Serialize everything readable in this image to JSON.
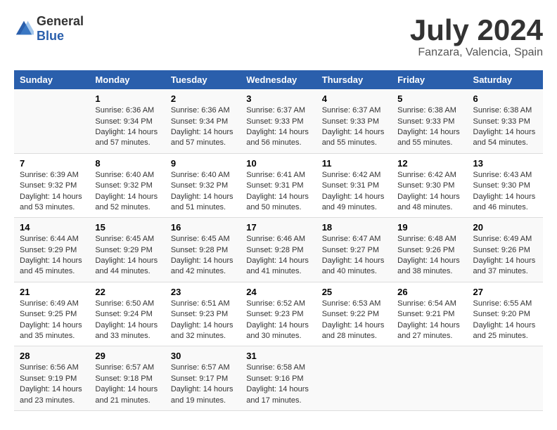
{
  "header": {
    "logo_general": "General",
    "logo_blue": "Blue",
    "title": "July 2024",
    "subtitle": "Fanzara, Valencia, Spain"
  },
  "days_of_week": [
    "Sunday",
    "Monday",
    "Tuesday",
    "Wednesday",
    "Thursday",
    "Friday",
    "Saturday"
  ],
  "weeks": [
    [
      {
        "day": "",
        "info": ""
      },
      {
        "day": "1",
        "info": "Sunrise: 6:36 AM\nSunset: 9:34 PM\nDaylight: 14 hours\nand 57 minutes."
      },
      {
        "day": "2",
        "info": "Sunrise: 6:36 AM\nSunset: 9:34 PM\nDaylight: 14 hours\nand 57 minutes."
      },
      {
        "day": "3",
        "info": "Sunrise: 6:37 AM\nSunset: 9:33 PM\nDaylight: 14 hours\nand 56 minutes."
      },
      {
        "day": "4",
        "info": "Sunrise: 6:37 AM\nSunset: 9:33 PM\nDaylight: 14 hours\nand 55 minutes."
      },
      {
        "day": "5",
        "info": "Sunrise: 6:38 AM\nSunset: 9:33 PM\nDaylight: 14 hours\nand 55 minutes."
      },
      {
        "day": "6",
        "info": "Sunrise: 6:38 AM\nSunset: 9:33 PM\nDaylight: 14 hours\nand 54 minutes."
      }
    ],
    [
      {
        "day": "7",
        "info": "Sunrise: 6:39 AM\nSunset: 9:32 PM\nDaylight: 14 hours\nand 53 minutes."
      },
      {
        "day": "8",
        "info": "Sunrise: 6:40 AM\nSunset: 9:32 PM\nDaylight: 14 hours\nand 52 minutes."
      },
      {
        "day": "9",
        "info": "Sunrise: 6:40 AM\nSunset: 9:32 PM\nDaylight: 14 hours\nand 51 minutes."
      },
      {
        "day": "10",
        "info": "Sunrise: 6:41 AM\nSunset: 9:31 PM\nDaylight: 14 hours\nand 50 minutes."
      },
      {
        "day": "11",
        "info": "Sunrise: 6:42 AM\nSunset: 9:31 PM\nDaylight: 14 hours\nand 49 minutes."
      },
      {
        "day": "12",
        "info": "Sunrise: 6:42 AM\nSunset: 9:30 PM\nDaylight: 14 hours\nand 48 minutes."
      },
      {
        "day": "13",
        "info": "Sunrise: 6:43 AM\nSunset: 9:30 PM\nDaylight: 14 hours\nand 46 minutes."
      }
    ],
    [
      {
        "day": "14",
        "info": "Sunrise: 6:44 AM\nSunset: 9:29 PM\nDaylight: 14 hours\nand 45 minutes."
      },
      {
        "day": "15",
        "info": "Sunrise: 6:45 AM\nSunset: 9:29 PM\nDaylight: 14 hours\nand 44 minutes."
      },
      {
        "day": "16",
        "info": "Sunrise: 6:45 AM\nSunset: 9:28 PM\nDaylight: 14 hours\nand 42 minutes."
      },
      {
        "day": "17",
        "info": "Sunrise: 6:46 AM\nSunset: 9:28 PM\nDaylight: 14 hours\nand 41 minutes."
      },
      {
        "day": "18",
        "info": "Sunrise: 6:47 AM\nSunset: 9:27 PM\nDaylight: 14 hours\nand 40 minutes."
      },
      {
        "day": "19",
        "info": "Sunrise: 6:48 AM\nSunset: 9:26 PM\nDaylight: 14 hours\nand 38 minutes."
      },
      {
        "day": "20",
        "info": "Sunrise: 6:49 AM\nSunset: 9:26 PM\nDaylight: 14 hours\nand 37 minutes."
      }
    ],
    [
      {
        "day": "21",
        "info": "Sunrise: 6:49 AM\nSunset: 9:25 PM\nDaylight: 14 hours\nand 35 minutes."
      },
      {
        "day": "22",
        "info": "Sunrise: 6:50 AM\nSunset: 9:24 PM\nDaylight: 14 hours\nand 33 minutes."
      },
      {
        "day": "23",
        "info": "Sunrise: 6:51 AM\nSunset: 9:23 PM\nDaylight: 14 hours\nand 32 minutes."
      },
      {
        "day": "24",
        "info": "Sunrise: 6:52 AM\nSunset: 9:23 PM\nDaylight: 14 hours\nand 30 minutes."
      },
      {
        "day": "25",
        "info": "Sunrise: 6:53 AM\nSunset: 9:22 PM\nDaylight: 14 hours\nand 28 minutes."
      },
      {
        "day": "26",
        "info": "Sunrise: 6:54 AM\nSunset: 9:21 PM\nDaylight: 14 hours\nand 27 minutes."
      },
      {
        "day": "27",
        "info": "Sunrise: 6:55 AM\nSunset: 9:20 PM\nDaylight: 14 hours\nand 25 minutes."
      }
    ],
    [
      {
        "day": "28",
        "info": "Sunrise: 6:56 AM\nSunset: 9:19 PM\nDaylight: 14 hours\nand 23 minutes."
      },
      {
        "day": "29",
        "info": "Sunrise: 6:57 AM\nSunset: 9:18 PM\nDaylight: 14 hours\nand 21 minutes."
      },
      {
        "day": "30",
        "info": "Sunrise: 6:57 AM\nSunset: 9:17 PM\nDaylight: 14 hours\nand 19 minutes."
      },
      {
        "day": "31",
        "info": "Sunrise: 6:58 AM\nSunset: 9:16 PM\nDaylight: 14 hours\nand 17 minutes."
      },
      {
        "day": "",
        "info": ""
      },
      {
        "day": "",
        "info": ""
      },
      {
        "day": "",
        "info": ""
      }
    ]
  ]
}
